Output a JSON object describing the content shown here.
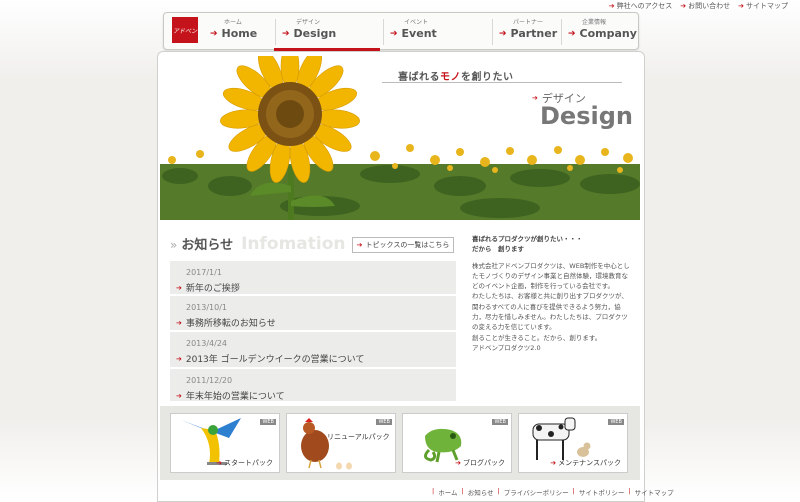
{
  "util_links": [
    "弊社へのアクセス",
    "お問い合わせ",
    "サイトマップ"
  ],
  "logo_text": "アドベン",
  "nav": [
    {
      "jp": "ホーム",
      "en": "Home"
    },
    {
      "jp": "デザイン",
      "en": "Design"
    },
    {
      "jp": "イベント",
      "en": "Event"
    },
    {
      "jp": "パートナー",
      "en": "Partner"
    },
    {
      "jp": "企業情報",
      "en": "Company"
    }
  ],
  "hero": {
    "catch_prefix": "喜ばれる",
    "catch_red": "モノ",
    "catch_suffix": "を創りたい",
    "section_jp": "デザイン",
    "section_en": "Design"
  },
  "news": {
    "title_jp": "お知らせ",
    "title_en": "Infomation",
    "topics_button": "トピックスの一覧はこちら",
    "items": [
      {
        "date": "2017/1/1",
        "title": "新年のご挨拶"
      },
      {
        "date": "2013/10/1",
        "title": "事務所移転のお知らせ"
      },
      {
        "date": "2013/4/24",
        "title": "2013年 ゴールデンウイークの営業について"
      },
      {
        "date": "2011/12/20",
        "title": "年末年始の営業について"
      }
    ]
  },
  "about": {
    "head1": "喜ばれるプロダクツが創りたい・・・",
    "head2": "だから　創ります",
    "p1": "株式会社アドベンプロダクツは、WEB制作を中心としたモノづくりのデザイン事業と自然体験，環境教育などのイベント企画，制作を行っている会社です。",
    "p2": "わたしたちは、お客様と共に創り出すプロダクツが、関わるすべての人に喜びを提供できるよう努力，協力，尽力を惜しみません。わたしたちは、プロダクツの変える力を信じています。",
    "p3": "創ることが生きること。だから、創ります。",
    "p4": "アドベンプロダクツ2.0"
  },
  "banners": [
    {
      "label": "スタートパック",
      "badge": "WEB"
    },
    {
      "label": "リニューアルパック",
      "badge": "WEB"
    },
    {
      "label": "ブログパック",
      "badge": "WEB"
    },
    {
      "label": "メンテナンスパック",
      "badge": "WEB"
    }
  ],
  "footer_links": [
    "ホーム",
    "お知らせ",
    "プライバシーポリシー",
    "サイトポリシー",
    "サイトマップ"
  ],
  "colors": {
    "accent": "#c4131a",
    "panel": "#ececea"
  }
}
